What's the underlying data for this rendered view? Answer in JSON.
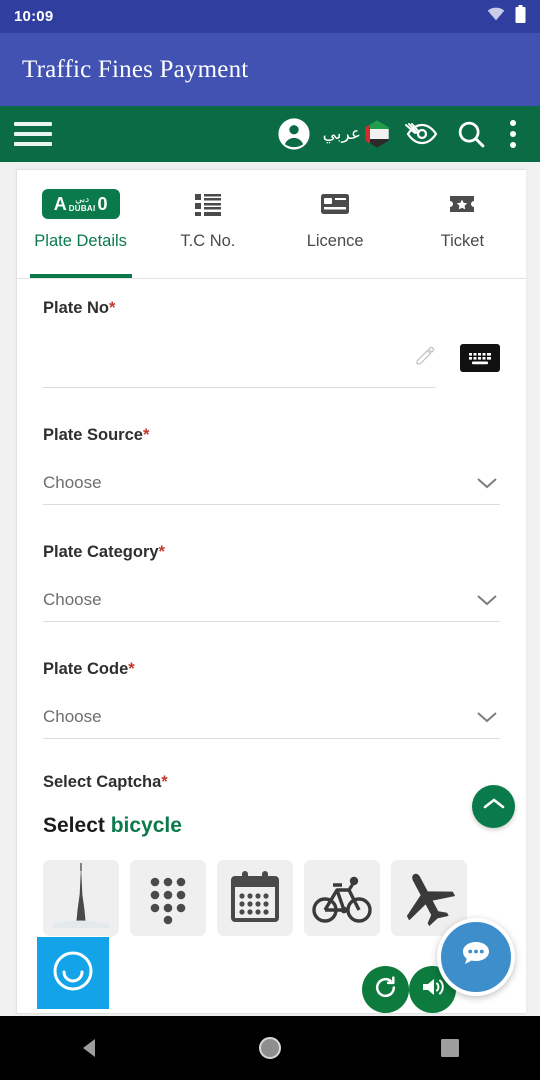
{
  "status_bar": {
    "time": "10:09",
    "icons": [
      "wifi-icon",
      "battery-icon"
    ]
  },
  "header": {
    "title": "Traffic Fines Payment",
    "background_color": "#4152b3"
  },
  "toolbar": {
    "background_color": "#0b6b44",
    "menu_icon": "hamburger-menu-icon",
    "account_icon": "account-circle-icon",
    "language_label": "عربي",
    "flag_icon": "uae-flag-icon",
    "accessibility_icon": "eye-slash-icon",
    "search_icon": "search-icon",
    "overflow_icon": "kebab-menu-icon"
  },
  "tabs": [
    {
      "label": "Plate Details",
      "icon": "dubai-plate-icon",
      "active": true
    },
    {
      "label": "T.C No.",
      "icon": "list-icon",
      "active": false
    },
    {
      "label": "Licence",
      "icon": "card-icon",
      "active": false
    },
    {
      "label": "Ticket",
      "icon": "ticket-icon",
      "active": false
    }
  ],
  "plate_icon": {
    "letter": "A",
    "arabic": "دبي",
    "english": "DUBAI",
    "number": "0"
  },
  "form": {
    "plate_no": {
      "label": "Plate No",
      "required": "*",
      "value": "",
      "placeholder": "",
      "edit_icon": "pencil-icon",
      "keyboard_icon": "keyboard-icon"
    },
    "plate_source": {
      "label": "Plate Source",
      "required": "*",
      "value": "Choose"
    },
    "plate_category": {
      "label": "Plate Category",
      "required": "*",
      "value": "Choose"
    },
    "plate_code": {
      "label": "Plate Code",
      "required": "*",
      "value": "Choose"
    }
  },
  "captcha": {
    "label": "Select Captcha",
    "required": "*",
    "prompt_prefix": "Select",
    "prompt_word": "bicycle",
    "accent_color": "#0b7a4b",
    "tiles": [
      {
        "name": "burj-khalifa-tile"
      },
      {
        "name": "dots-grid-tile"
      },
      {
        "name": "calendar-tile"
      },
      {
        "name": "bicycle-tile"
      },
      {
        "name": "airplane-tile"
      }
    ],
    "refresh_icon": "refresh-icon",
    "audio_icon": "speaker-icon"
  },
  "floating": {
    "scroll_top_icon": "chevron-up-icon",
    "accessibility_widget_icon": "smiley-face-icon",
    "chat_icon": "chat-bubble-icon"
  },
  "nav_bar": {
    "back": "back-triangle-icon",
    "home": "home-circle-icon",
    "recents": "recents-square-icon"
  }
}
